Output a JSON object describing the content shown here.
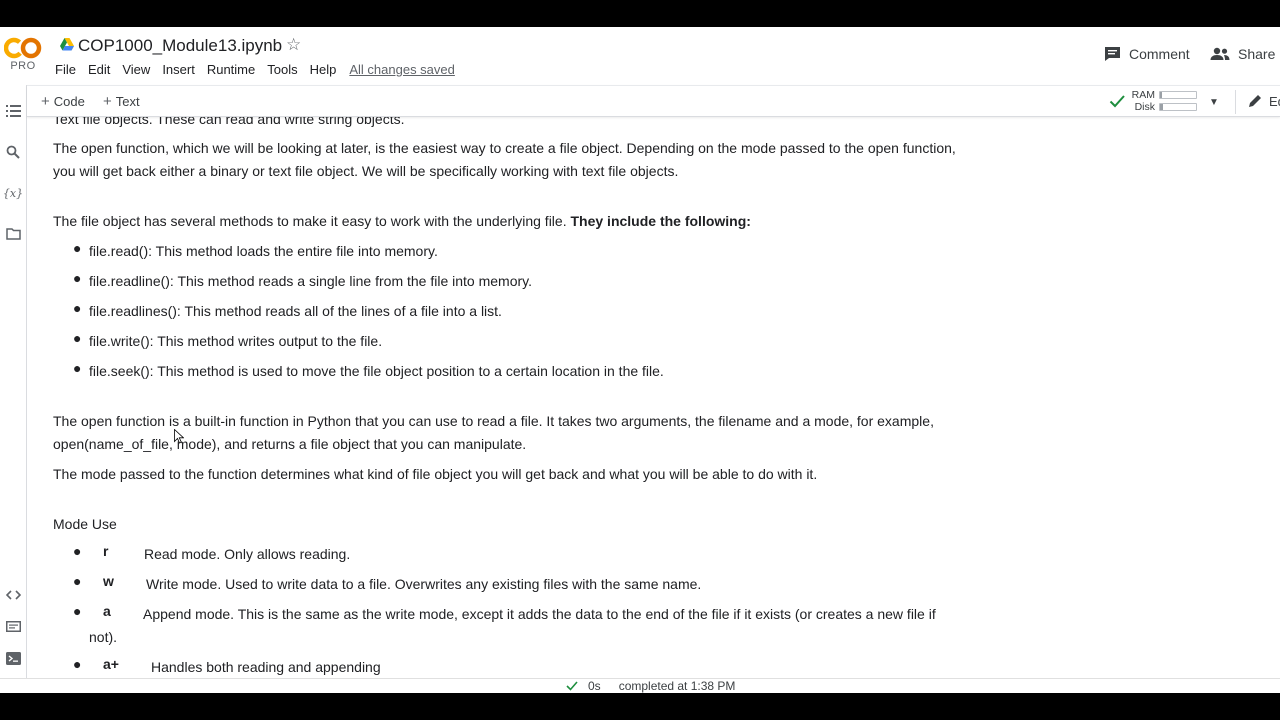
{
  "header": {
    "logo_text": "CO",
    "logo_tier": "PRO",
    "title": "COP1000_Module13.ipynb",
    "menu": [
      "File",
      "Edit",
      "View",
      "Insert",
      "Runtime",
      "Tools",
      "Help"
    ],
    "save_status": "All changes saved",
    "comment_label": "Comment",
    "share_label": "Share"
  },
  "toolbar": {
    "code_label": "Code",
    "text_label": "Text",
    "ram_label": "RAM",
    "disk_label": "Disk",
    "ram_usage": 0.05,
    "disk_usage": 0.08,
    "edit_label": "Ed"
  },
  "content": {
    "top_clipped": "Text file objects. These can read and write string objects.",
    "para1": "The open function, which we will be looking at later, is the easiest way to create a file object. Depending on the mode passed to the open function, you will get back either a binary or text file object. We will be specifically working with text file objects.",
    "para2_text": "The file object has several methods to make it easy to work with the underlying file. ",
    "para2_bold": "They include the following:",
    "methods": [
      "file.read(): This method loads the entire file into memory.",
      "file.readline(): This method reads a single line from the file into memory.",
      "file.readlines(): This method reads all of the lines of a file into a list.",
      "file.write(): This method writes output to the file.",
      "file.seek(): This method is used to move the file object position to a certain location in the file."
    ],
    "para3": "The open function is a built-in function in Python that you can use to read a file. It takes two arguments, the filename and a mode, for example, open(name_of_file, mode), and returns a file object that you can manipulate.",
    "para4": "The mode passed to the function determines what kind of file object you will get back and what you will be able to do with it.",
    "mode_heading": "Mode Use",
    "modes": [
      {
        "key": "r",
        "desc": "Read mode. Only allows reading."
      },
      {
        "key": "w",
        "desc": "Write mode. Used to write data to a file. Overwrites any existing files with the same name."
      },
      {
        "key": "a",
        "desc": "Append mode. This is the same as the write mode, except it adds the data to the end of the file if it exists (or creates a new file if",
        "desc_cont": "not)."
      },
      {
        "key": "a+",
        "desc": "Handles both reading and appending"
      }
    ]
  },
  "status": {
    "duration": "0s",
    "completed": "completed at 1:38 PM"
  },
  "colors": {
    "logo_orange": "#f9ab00",
    "logo_orange_dark": "#e37400",
    "check_green": "#1e8e3e"
  }
}
